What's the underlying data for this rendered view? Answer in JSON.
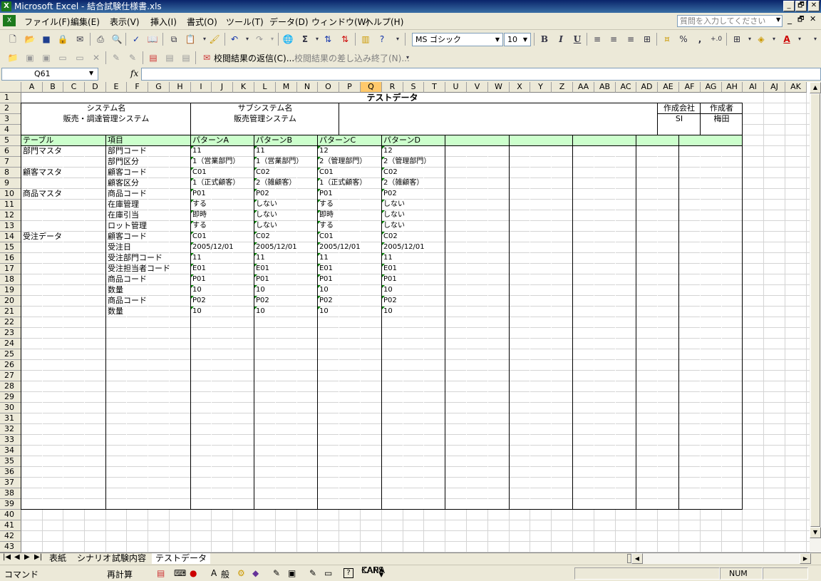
{
  "window": {
    "title": "Microsoft Excel - 結合試験仕様書.xls",
    "app_icon": "excel-icon",
    "buttons": {
      "minimize": "_",
      "restore": "🗗",
      "close": "✕"
    }
  },
  "menu": {
    "icon": "excel-doc-icon",
    "items": [
      "ファイル(F)",
      "編集(E)",
      "表示(V)",
      "挿入(I)",
      "書式(O)",
      "ツール(T)",
      "データ(D)",
      "ウィンドウ(W)",
      "ヘルプ(H)"
    ],
    "help_placeholder": "質問を入力してください"
  },
  "toolbar": {
    "font_name": "MS ゴシック",
    "font_size": "10",
    "bold": "B",
    "italic": "I",
    "underline": "U",
    "sigma": "Σ",
    "percent": "%",
    "comma": ","
  },
  "reviewing_toolbar": {
    "reply": "校閲結果の返信(C)...",
    "end_review": "校閲結果の差し込み終了(N)..."
  },
  "formula_bar": {
    "name_box": "Q61",
    "fx": "fx",
    "value": ""
  },
  "columns": [
    "A",
    "B",
    "C",
    "D",
    "E",
    "F",
    "G",
    "H",
    "I",
    "J",
    "K",
    "L",
    "M",
    "N",
    "O",
    "P",
    "Q",
    "R",
    "S",
    "T",
    "U",
    "V",
    "W",
    "X",
    "Y",
    "Z",
    "AA",
    "AB",
    "AC",
    "AD",
    "AE",
    "AF",
    "AG",
    "AH",
    "AI",
    "AJ",
    "AK"
  ],
  "row_count": 43,
  "selected_column": "Q",
  "sheet": {
    "title": "テストデータ",
    "system_label": "システム名",
    "system_value": "販売・調達管理システム",
    "subsystem_label": "サブシステム名",
    "subsystem_value": "販売管理システム",
    "company_label": "作成会社",
    "company_value": "SI",
    "author_label": "作成者",
    "author_value": "梅田",
    "headers": {
      "table": "テーブル",
      "item": "項目",
      "patterns": [
        "パターンA",
        "パターンB",
        "パターンC",
        "パターンD"
      ]
    },
    "rows": [
      {
        "table": "部門マスタ",
        "item": "部門コード",
        "values": [
          "11",
          "11",
          "12",
          "12"
        ],
        "text_num": true
      },
      {
        "table": "",
        "item": "部門区分",
        "values": [
          "1（営業部門）",
          "1（営業部門）",
          "2（管理部門）",
          "2（管理部門）"
        ]
      },
      {
        "table": "顧客マスタ",
        "item": "顧客コード",
        "values": [
          "C01",
          "C02",
          "C01",
          "C02"
        ]
      },
      {
        "table": "",
        "item": "顧客区分",
        "values": [
          "1（正式顧客）",
          "2（雑顧客）",
          "1（正式顧客）",
          "2（雑顧客）"
        ]
      },
      {
        "table": "商品マスタ",
        "item": "商品コード",
        "values": [
          "P01",
          "P02",
          "P01",
          "P02"
        ]
      },
      {
        "table": "",
        "item": "在庫管理",
        "values": [
          "する",
          "しない",
          "する",
          "しない"
        ]
      },
      {
        "table": "",
        "item": "在庫引当",
        "values": [
          "即時",
          "しない",
          "即時",
          "しない"
        ]
      },
      {
        "table": "",
        "item": "ロット管理",
        "values": [
          "する",
          "しない",
          "する",
          "しない"
        ]
      },
      {
        "table": "受注データ",
        "item": "顧客コード",
        "values": [
          "C01",
          "C02",
          "C01",
          "C02"
        ]
      },
      {
        "table": "",
        "item": "受注日",
        "values": [
          "2005/12/01",
          "2005/12/01",
          "2005/12/01",
          "2005/12/01"
        ]
      },
      {
        "table": "",
        "item": "受注部門コード",
        "values": [
          "11",
          "11",
          "11",
          "11"
        ],
        "text_num": true
      },
      {
        "table": "",
        "item": "受注担当者コード",
        "values": [
          "E01",
          "E01",
          "E01",
          "E01"
        ]
      },
      {
        "table": "",
        "item": "商品コード",
        "values": [
          "P01",
          "P01",
          "P01",
          "P01"
        ]
      },
      {
        "table": "",
        "item": "数量",
        "values": [
          "10",
          "10",
          "10",
          "10"
        ],
        "text_num": true
      },
      {
        "table": "",
        "item": "商品コード",
        "values": [
          "P02",
          "P02",
          "P02",
          "P02"
        ]
      },
      {
        "table": "",
        "item": "数量",
        "values": [
          "10",
          "10",
          "10",
          "10"
        ],
        "text_num": true
      }
    ]
  },
  "tabs": [
    "表紙",
    "シナリオ",
    "試験内容",
    "テストデータ"
  ],
  "active_tab": "テストデータ",
  "status": {
    "mode": "コマンド",
    "recalc": "再計算",
    "num": "NUM",
    "caps": "CAPS",
    "kana": "KANA",
    "font_btn": "A",
    "kana_btn": "般"
  }
}
